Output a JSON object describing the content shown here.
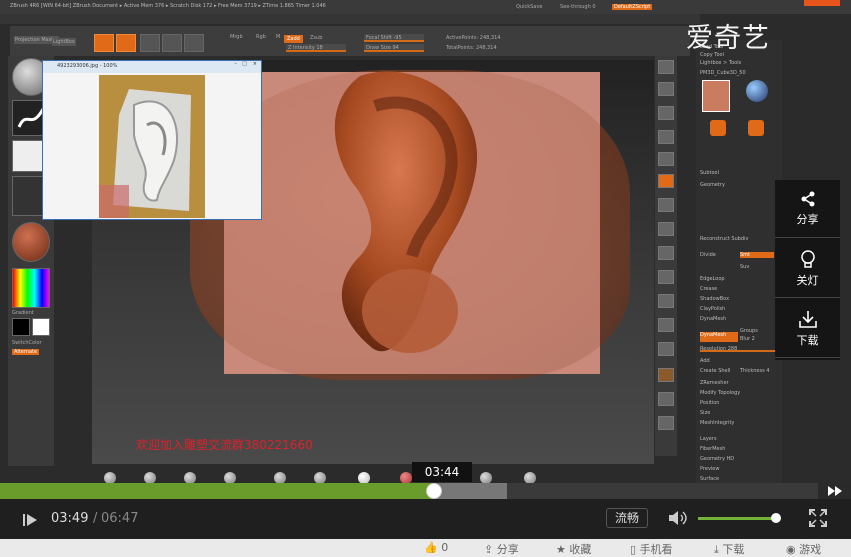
{
  "zbrush": {
    "window_title": "ZBrush 4R6 [WIN 64-bit]   ZBrush Document   ▸ Active Mem 376 ▸ Scratch Disk 172 ▸ Free Mem 3719 ▸ ZTime 1.865 Timer 1.046",
    "quicksave": "QuickSave",
    "seethrough": "See-through 0",
    "menus": "DefaultZScript",
    "reference_window_title": "4923293006.jpg - 100%",
    "toolbar": {
      "projection_master": "Projection Master",
      "lightbox": "LightBox",
      "zadd": "Zadd",
      "zsub": "Zsub",
      "focal_shift": "Focal Shift -95",
      "draw_size": "Draw Size 94",
      "z_intensity": "Z Intensity 18",
      "active_points": "ActivePoints: 248,314",
      "total_points": "TotalPoints: 248,314",
      "rgb": "Rgb",
      "mrgb": "Mrgb",
      "m": "M"
    },
    "left_tray": {
      "gradient": "Gradient",
      "switch_color": "SwitchColor",
      "alternate": "Alternate"
    },
    "right_tray": {
      "load_tool": "Load Tool",
      "save_as": "Save As",
      "copy_tool": "Copy Tool",
      "import": "Import",
      "export": "Export",
      "lightbox_tools": "Lightbox > Tools",
      "tool_name": "PM3D_Cube3D_50",
      "subtool": "Subtool",
      "geometry": "Geometry",
      "reconstruct": "Reconstruct Subdiv",
      "divide": "Divide",
      "smt": "Smt",
      "suv": "Suv",
      "edgeloop": "EdgeLoop",
      "crease": "Crease",
      "shadowbox": "ShadowBox",
      "claypolish": "ClayPolish",
      "dynamesh": "DynaMesh",
      "dynamesh_btn": "DynaMesh",
      "groups": "Groups",
      "polish": "Polish",
      "blur": "Blur 2",
      "project": "Project",
      "resolution": "Resolution 288",
      "add": "Add",
      "sub": "Sub",
      "and": "And",
      "create_shell": "Create Shell",
      "thickness": "Thickness 4",
      "zremesher": "ZRemesher",
      "modify_topology": "Modify Topology",
      "position": "Position",
      "size": "Size",
      "meshintegrity": "MeshIntegrity",
      "layers": "Layers",
      "fibermesh": "FiberMesh",
      "geometry_hd": "Geometry HD",
      "preview": "Preview",
      "surface": "Surface",
      "deformation": "Deformation"
    },
    "watermark_text": "欢迎加入雕塑交流群380221660"
  },
  "player": {
    "logo": "爱奇艺",
    "side_panel": [
      {
        "label": "分享",
        "icon": "share-icon"
      },
      {
        "label": "关灯",
        "icon": "bulb-icon"
      },
      {
        "label": "下载",
        "icon": "download-icon"
      }
    ],
    "hover_time": "03:44",
    "current_time": "03:49",
    "time_separator": "/",
    "total_time": "06:47",
    "progress": 0.53,
    "buffered": 0.62,
    "quality": "流畅",
    "volume": 0.98,
    "accent_color": "#699c2a",
    "brand_color": "#e8541c",
    "actions": [
      {
        "label": "0",
        "icon": "thumbs-up-icon"
      },
      {
        "label": "分享",
        "icon": "share-icon"
      },
      {
        "label": "收藏",
        "icon": "star-icon"
      },
      {
        "label": "手机看",
        "icon": "phone-icon"
      },
      {
        "label": "下载",
        "icon": "download-icon"
      },
      {
        "label": "游戏",
        "icon": "game-icon"
      }
    ]
  }
}
